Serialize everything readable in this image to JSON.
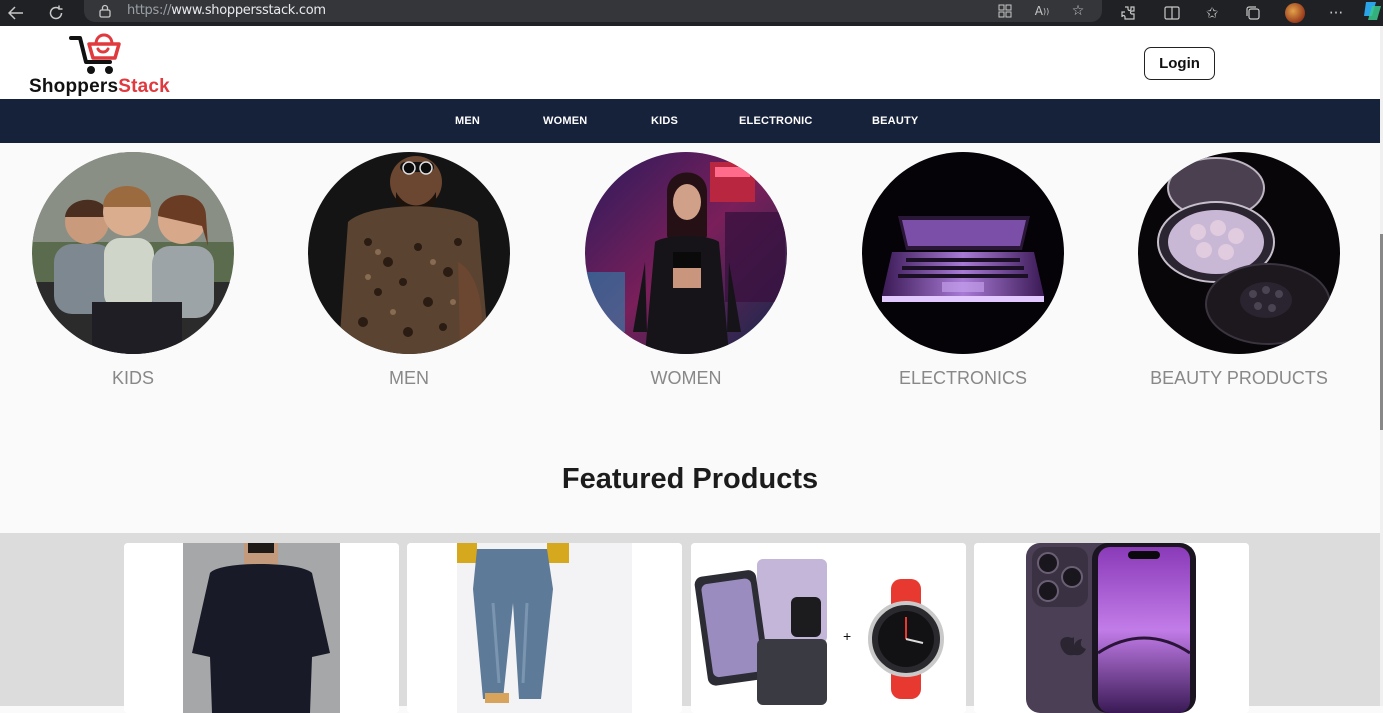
{
  "browser": {
    "url_protocol": "https://",
    "url_host": "www.shoppersstack.com",
    "icons": [
      "back-icon",
      "refresh-icon",
      "lock-icon",
      "app-grid-icon",
      "read-aloud-icon",
      "favorite-star-icon",
      "extensions-icon",
      "split-screen-icon",
      "favorites-icon",
      "collections-icon",
      "profile-avatar",
      "more-icon"
    ]
  },
  "header": {
    "logo_part1": "Shoppers",
    "logo_part2": "Stack",
    "login_label": "Login"
  },
  "nav": {
    "items": [
      "MEN",
      "WOMEN",
      "KIDS",
      "ELECTRONIC",
      "BEAUTY"
    ]
  },
  "categories": {
    "items": [
      {
        "label": "KIDS"
      },
      {
        "label": "MEN"
      },
      {
        "label": "WOMEN"
      },
      {
        "label": "ELECTRONICS"
      },
      {
        "label": "BEAUTY PRODUCTS"
      }
    ]
  },
  "featured": {
    "title": "Featured Products"
  },
  "colors": {
    "brand_red": "#e0393e",
    "nav_bg": "#16213a",
    "category_label": "#888888",
    "band_bg": "#dcdcdc"
  }
}
